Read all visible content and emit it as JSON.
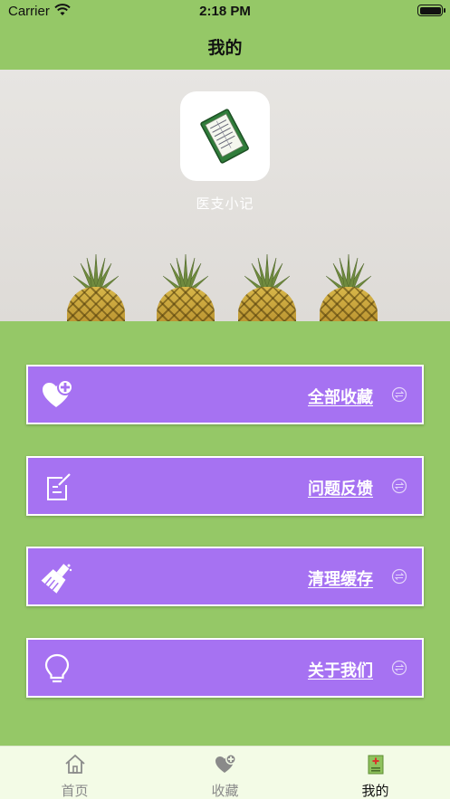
{
  "status_bar": {
    "carrier": "Carrier",
    "time": "2:18 PM"
  },
  "nav": {
    "title": "我的"
  },
  "profile": {
    "app_name": "医支小记",
    "icon": "clipboard-document-icon"
  },
  "menu": [
    {
      "label": "全部收藏",
      "icon": "heart-plus-icon"
    },
    {
      "label": "问题反馈",
      "icon": "edit-note-icon"
    },
    {
      "label": "清理缓存",
      "icon": "broom-icon"
    },
    {
      "label": "关于我们",
      "icon": "lightbulb-icon"
    }
  ],
  "tabs": [
    {
      "label": "首页",
      "icon": "home-icon",
      "active": false
    },
    {
      "label": "收藏",
      "icon": "heart-plus-icon",
      "active": false
    },
    {
      "label": "我的",
      "icon": "medical-kit-icon",
      "active": true
    }
  ],
  "colors": {
    "background": "#95c867",
    "menu_item": "#a672f2",
    "tab_bar": "#f3fbe6"
  }
}
